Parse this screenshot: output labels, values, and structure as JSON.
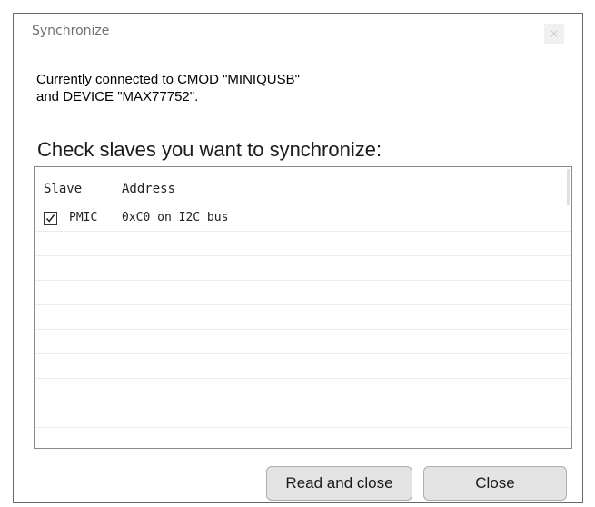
{
  "window": {
    "title": "Synchronize",
    "close_glyph": "×"
  },
  "info": {
    "line1": "Currently connected to CMOD \"MINIQUSB\"",
    "line2": "and DEVICE \"MAX77752\"."
  },
  "heading": "Check slaves you want to synchronize:",
  "table": {
    "columns": [
      "Slave",
      "Address"
    ],
    "rows": [
      {
        "slave": "PMIC",
        "address": "0xC0 on I2C bus",
        "checked": true
      }
    ]
  },
  "buttons": {
    "read_and_close": "Read and close",
    "close": "Close"
  }
}
